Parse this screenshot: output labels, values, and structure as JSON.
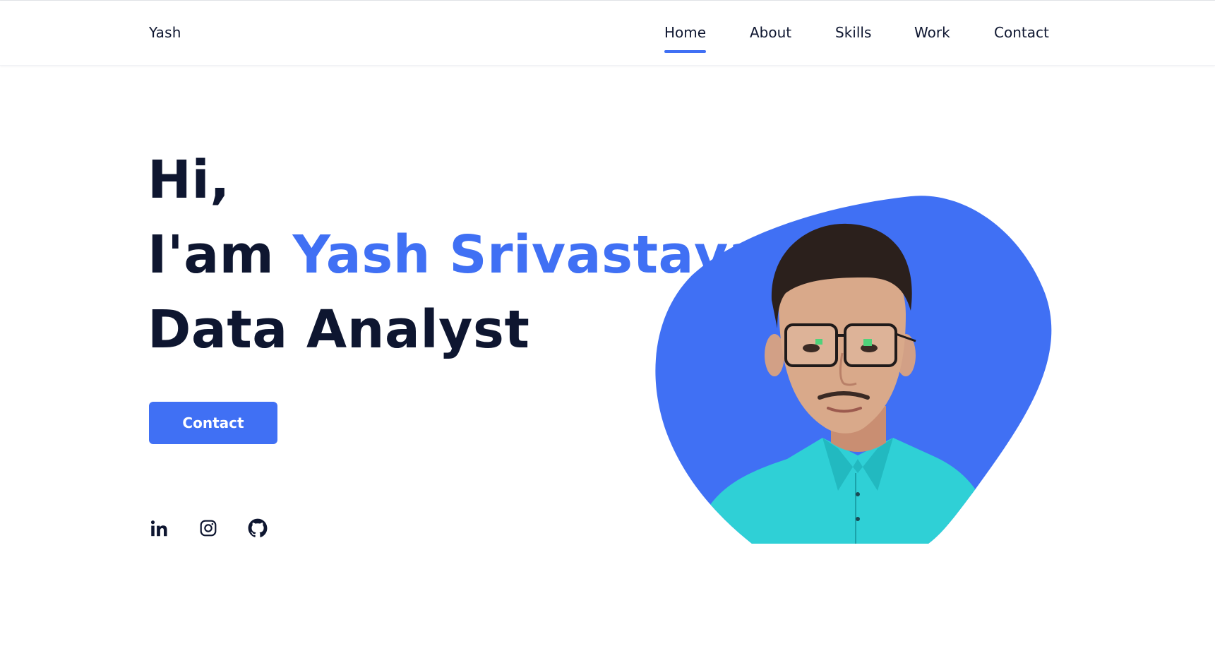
{
  "header": {
    "logo": "Yash",
    "nav": [
      {
        "label": "Home",
        "active": true
      },
      {
        "label": "About",
        "active": false
      },
      {
        "label": "Skills",
        "active": false
      },
      {
        "label": "Work",
        "active": false
      },
      {
        "label": "Contact",
        "active": false
      }
    ]
  },
  "hero": {
    "greeting": "Hi,",
    "intro_prefix": "I'am",
    "name": "Yash Srivastava",
    "role": "Data Analyst",
    "contact_button": "Contact",
    "social_icons": [
      "linkedin-icon",
      "instagram-icon",
      "github-icon"
    ]
  },
  "colors": {
    "accent": "#4070f4",
    "text": "#0e1630",
    "shirt": "#2fd0d6",
    "skin": "#d9a98a",
    "hair": "#2b201c"
  }
}
